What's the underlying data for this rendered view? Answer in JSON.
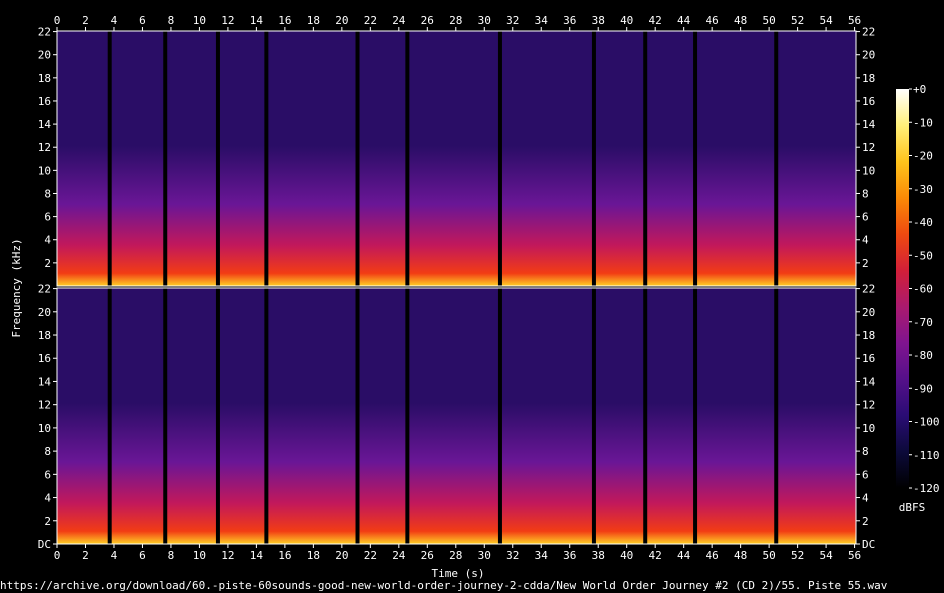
{
  "source_url": "https://archive.org/download/60.-piste-60sounds-good-new-world-order-journey-2-cdda/New World Order Journey #2 (CD 2)/55. Piste 55.wav",
  "chart_data": {
    "type": "heatmap",
    "subtype": "spectrogram",
    "channels": 2,
    "xlabel": "Time (s)",
    "ylabel": "Frequency (kHz)",
    "xlim": [
      0,
      56.1
    ],
    "ylim": [
      0,
      22.05
    ],
    "x_ticks": [
      "0",
      "2",
      "4",
      "6",
      "8",
      "10",
      "12",
      "14",
      "16",
      "18",
      "20",
      "22",
      "24",
      "26",
      "28",
      "30",
      "32",
      "34",
      "36",
      "38",
      "40",
      "42",
      "44",
      "46",
      "48",
      "50",
      "52",
      "54",
      "56"
    ],
    "y_ticks_upper": [
      "22",
      "20",
      "18",
      "16",
      "14",
      "12",
      "10",
      "8",
      "6",
      "4",
      "2"
    ],
    "y_ticks_lower": [
      "22",
      "20",
      "18",
      "16",
      "14",
      "12",
      "10",
      "8",
      "6",
      "4",
      "2",
      "DC"
    ],
    "colorbar": {
      "label": "dBFS",
      "range": [
        -120,
        0
      ],
      "ticks": [
        "+0",
        "-10",
        "-20",
        "-30",
        "-40",
        "-50",
        "-60",
        "-70",
        "-80",
        "-90",
        "-100",
        "-110",
        "-120"
      ],
      "colors": [
        "#000000",
        "#0c0a3a",
        "#2a0c74",
        "#55108a",
        "#80148f",
        "#aa1a6e",
        "#d21f38",
        "#ef4a10",
        "#fb8a06",
        "#ffc41c",
        "#fff07a",
        "#ffffff"
      ]
    },
    "silence_gaps_s": [
      3.7,
      7.6,
      11.3,
      14.7,
      21.1,
      24.6,
      31.1,
      37.7,
      41.3,
      44.8,
      50.5
    ],
    "segment_colors": {
      "silence": "#000000",
      "high_band": "#2a0d66",
      "mid_band": "#6a1696",
      "upper_low_band": "#c2185b",
      "low_band": "#f23c14",
      "bass_band": "#ffd026"
    },
    "frame_color": "#ffffff"
  }
}
